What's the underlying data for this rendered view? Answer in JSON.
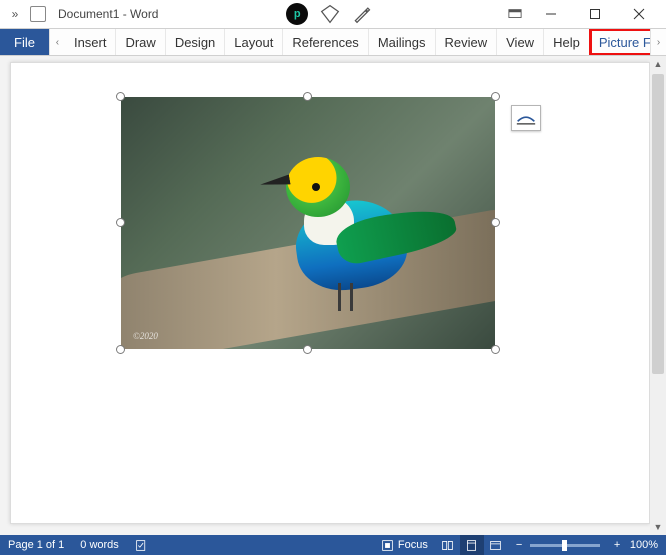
{
  "title": "Document1 - Word",
  "ribbon": {
    "file": "File",
    "tabs": [
      "Insert",
      "Draw",
      "Design",
      "Layout",
      "References",
      "Mailings",
      "Review",
      "View",
      "Help"
    ],
    "context_tab": "Picture Format"
  },
  "image": {
    "watermark": "©2020"
  },
  "status": {
    "page": "Page 1 of 1",
    "words": "0 words",
    "focus": "Focus",
    "zoom": "100%",
    "zoom_minus": "−",
    "zoom_plus": "+"
  }
}
